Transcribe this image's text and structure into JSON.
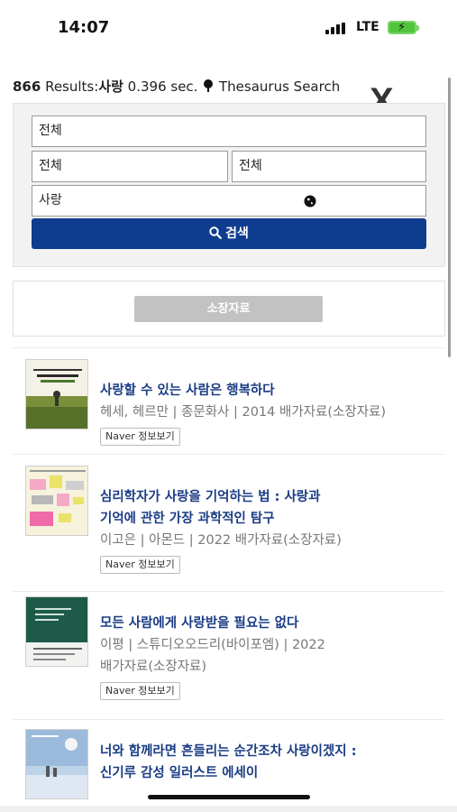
{
  "status": {
    "time": "14:07",
    "network": "LTE"
  },
  "summary": {
    "count": "866",
    "results_label": " Results:",
    "query": "사랑",
    "time": " 0.396 sec.",
    "thesaurus": " Thesaurus Search"
  },
  "close_label": "X",
  "search": {
    "field1": "전체",
    "field2": "전체",
    "field3": "전체",
    "keyword": "사랑",
    "button_label": "검색"
  },
  "holdings_button": "소장자료",
  "books": [
    {
      "title_lines": [
        "사랑할 수 있는 사람은 행복하다"
      ],
      "meta_lines": [
        "헤세, 헤르만 | 종문화사 | 2014 배가자료(소장자료)"
      ],
      "naver_label": "Naver 정보보기"
    },
    {
      "title_lines": [
        "심리학자가 사랑을 기억하는 법 : 사랑과",
        "기억에 관한 가장 과학적인 탐구"
      ],
      "meta_lines": [
        "이고은 | 아몬드 | 2022 배가자료(소장자료)"
      ],
      "naver_label": "Naver 정보보기"
    },
    {
      "title_lines": [
        "모든 사람에게 사랑받을 필요는 없다"
      ],
      "meta_lines": [
        "이평 | 스튜디오오드리(바이포엠) | 2022",
        "배가자료(소장자료)"
      ],
      "naver_label": "Naver 정보보기"
    },
    {
      "title_lines": [
        "너와 함께라면 흔들리는 순간조차 사랑이겠지 :",
        "신기루 감성 일러스트 에세이"
      ],
      "meta_lines": [],
      "naver_label": ""
    }
  ],
  "colors": {
    "search_button": "#0e3d8f",
    "title_text": "#1a3c84",
    "holdings_button": "#c2c2c2"
  },
  "icons": [
    "signal-icon",
    "battery-charging-icon",
    "tree-icon",
    "globe-icon",
    "search-icon"
  ]
}
